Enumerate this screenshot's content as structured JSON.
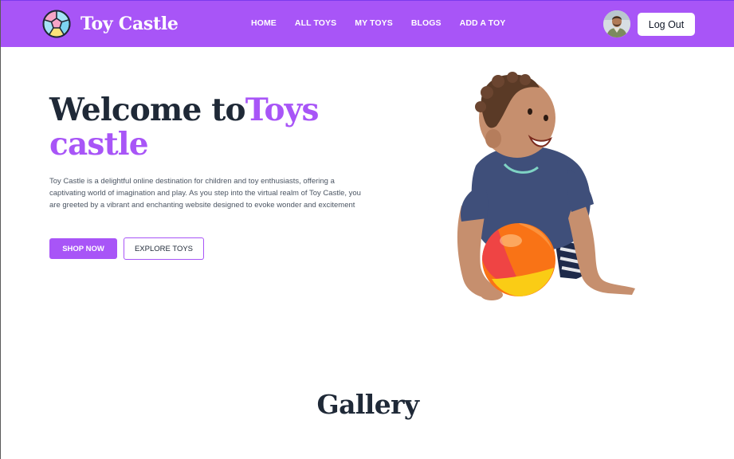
{
  "brand": {
    "name": "Toy Castle",
    "logo_icon": "toy-ball-logo-icon"
  },
  "nav": {
    "items": [
      {
        "label": "HOME"
      },
      {
        "label": "ALL TOYS"
      },
      {
        "label": "MY TOYS"
      },
      {
        "label": "BLOGS"
      },
      {
        "label": "ADD A TOY"
      }
    ]
  },
  "user": {
    "avatar_icon": "user-avatar-icon",
    "logout_label": "Log Out"
  },
  "hero": {
    "title_part1": "Welcome to",
    "title_part2": "Toys castle",
    "description": "Toy Castle is a delightful online destination for children and toy enthusiasts, offering a captivating world of imagination and play. As you step into the virtual realm of Toy Castle, you are greeted by a vibrant and enchanting website designed to evoke wonder and excitement",
    "primary_button": "SHOP NOW",
    "secondary_button": "EXPLORE TOYS",
    "image_icon": "child-with-ball-image"
  },
  "gallery": {
    "title": "Gallery"
  },
  "colors": {
    "brand_purple": "#a855f7",
    "heading_dark": "#1f2937",
    "body_text": "#4b5563",
    "white": "#ffffff"
  }
}
